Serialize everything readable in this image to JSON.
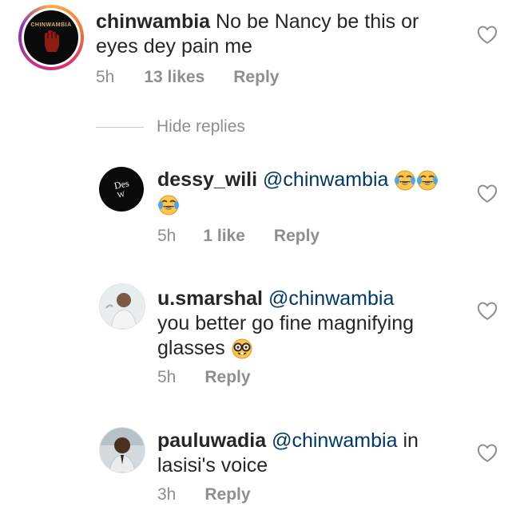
{
  "comments": [
    {
      "username": "chinwambia",
      "text_line1": "No be Nancy be this or",
      "text_line2": "eyes dey pain me",
      "time": "5h",
      "likes": "13 likes",
      "reply": "Reply",
      "avatar_text": "CHINWAMBIA"
    }
  ],
  "hide_replies": "Hide replies",
  "replies": [
    {
      "username": "dessy_wili",
      "mention": "@chinwambia",
      "text": "",
      "time": "5h",
      "likes": "1 like",
      "reply": "Reply",
      "avatar_text_top": "Des",
      "avatar_text_bottom": "W"
    },
    {
      "username": "u.smarshal",
      "mention": "@chinwambia",
      "text_line2": "you better go fine magnifying",
      "text_line3": "glasses",
      "time": "5h",
      "reply": "Reply"
    },
    {
      "username": "pauluwadia",
      "mention": "@chinwambia",
      "text_tail": "in",
      "text_line2": "lasisi's voice",
      "time": "3h",
      "reply": "Reply"
    }
  ],
  "colors": {
    "username": "#262626",
    "mention": "#00376b",
    "meta": "#8e8e8e",
    "heart_outline": "#8e8e8e"
  },
  "icons": {
    "like": "heart-outline-icon",
    "laugh": "tears-of-joy-emoji",
    "nerd": "nerd-face-emoji"
  }
}
